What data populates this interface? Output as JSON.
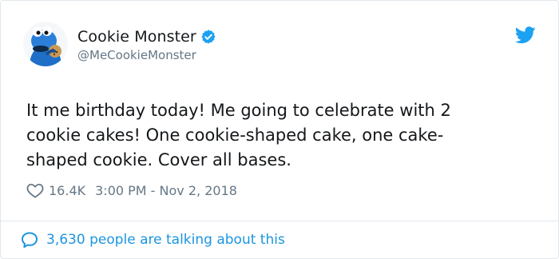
{
  "author": {
    "display_name": "Cookie Monster",
    "handle": "@MeCookieMonster",
    "avatar_icon": "cookie-monster-avatar",
    "verified_icon": "verified-badge-icon"
  },
  "brand": {
    "icon": "twitter-bird-icon",
    "accent_color": "#1da1f2"
  },
  "tweet": {
    "lines": [
      "It me birthday today! Me going to celebrate with 2",
      "cookie cakes! One cookie-shaped cake, one cake-",
      "shaped cookie. Cover all bases."
    ],
    "likes": "16.4K",
    "timestamp": "3:00 PM - Nov 2, 2018"
  },
  "footer": {
    "conversation_label": "3,630 people are talking about this",
    "conversation_icon": "speech-bubble-icon"
  }
}
